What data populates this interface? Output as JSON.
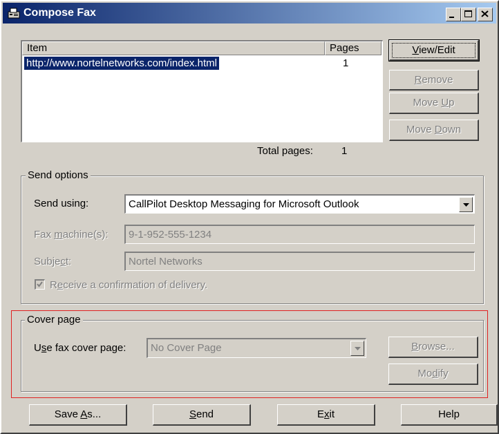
{
  "window": {
    "title": "Compose Fax"
  },
  "items_list": {
    "columns": [
      "Item",
      "Pages"
    ],
    "rows": [
      {
        "item": "http://www.nortelnetworks.com/index.html",
        "pages": "1"
      }
    ],
    "total_label": "Total pages:",
    "total_value": "1"
  },
  "list_buttons": {
    "view_edit": {
      "pre": "",
      "key": "V",
      "post": "iew/Edit"
    },
    "remove": {
      "pre": "",
      "key": "R",
      "post": "emove"
    },
    "move_up": {
      "pre": "Move ",
      "key": "U",
      "post": "p"
    },
    "move_down": {
      "pre": "Move ",
      "key": "D",
      "post": "own"
    }
  },
  "send_options": {
    "legend": "Send options",
    "send_using_label": "Send using:",
    "send_using_value": "CallPilot Desktop Messaging for Microsoft Outlook",
    "fax_machines_label": {
      "pre": "Fax ",
      "key": "m",
      "post": "achine(s):"
    },
    "fax_machines_value": "9-1-952-555-1234",
    "subject_label": {
      "pre": "Subje",
      "key": "c",
      "post": "t:"
    },
    "subject_value": "Nortel Networks",
    "confirmation_label": {
      "pre": "R",
      "key": "e",
      "post": "ceive a confirmation of delivery."
    },
    "confirmation_checked": true
  },
  "cover_page": {
    "legend": "Cover page",
    "use_label": {
      "pre": "U",
      "key": "s",
      "post": "e fax cover page:"
    },
    "use_value": "No Cover Page",
    "browse": {
      "pre": "",
      "key": "B",
      "post": "rowse..."
    },
    "modify": {
      "pre": "Mo",
      "key": "d",
      "post": "ify"
    }
  },
  "bottom_buttons": {
    "save_as": {
      "pre": "Save ",
      "key": "A",
      "post": "s..."
    },
    "send": {
      "pre": "",
      "key": "S",
      "post": "end"
    },
    "exit": {
      "pre": "E",
      "key": "x",
      "post": "it"
    },
    "help": {
      "pre": "Help",
      "key": "",
      "post": ""
    }
  },
  "colors": {
    "title_start": "#0a246a",
    "title_end": "#a6caf0",
    "selection": "#0a246a",
    "highlight_border": "#e02020",
    "face": "#d4d0c8"
  }
}
